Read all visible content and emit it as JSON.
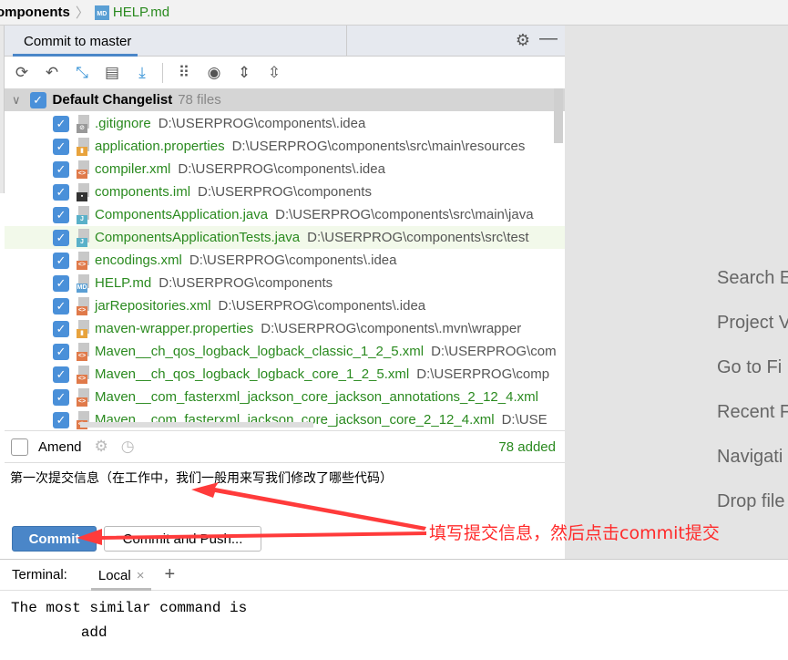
{
  "breadcrumb": {
    "project": "omponents",
    "file": "HELP.md"
  },
  "commit_panel": {
    "tab": "Commit to master",
    "changelist": {
      "name": "Default Changelist",
      "count": "78 files"
    },
    "files": [
      {
        "name": ".gitignore",
        "path": "D:\\USERPROG\\components\\.idea",
        "type": "ignore"
      },
      {
        "name": "application.properties",
        "path": "D:\\USERPROG\\components\\src\\main\\resources",
        "type": "properties"
      },
      {
        "name": "compiler.xml",
        "path": "D:\\USERPROG\\components\\.idea",
        "type": "xml"
      },
      {
        "name": "components.iml",
        "path": "D:\\USERPROG\\components",
        "type": "iml"
      },
      {
        "name": "ComponentsApplication.java",
        "path": "D:\\USERPROG\\components\\src\\main\\java",
        "type": "java"
      },
      {
        "name": "ComponentsApplicationTests.java",
        "path": "D:\\USERPROG\\components\\src\\test",
        "type": "java"
      },
      {
        "name": "encodings.xml",
        "path": "D:\\USERPROG\\components\\.idea",
        "type": "xml"
      },
      {
        "name": "HELP.md",
        "path": "D:\\USERPROG\\components",
        "type": "md"
      },
      {
        "name": "jarRepositories.xml",
        "path": "D:\\USERPROG\\components\\.idea",
        "type": "xml"
      },
      {
        "name": "maven-wrapper.properties",
        "path": "D:\\USERPROG\\components\\.mvn\\wrapper",
        "type": "properties"
      },
      {
        "name": "Maven__ch_qos_logback_logback_classic_1_2_5.xml",
        "path": "D:\\USERPROG\\com",
        "type": "xml"
      },
      {
        "name": "Maven__ch_qos_logback_logback_core_1_2_5.xml",
        "path": "D:\\USERPROG\\comp",
        "type": "xml"
      },
      {
        "name": "Maven__com_fasterxml_jackson_core_jackson_annotations_2_12_4.xml",
        "path": "",
        "type": "xml"
      },
      {
        "name": "Maven__com_fasterxml_jackson_core_jackson_core_2_12_4.xml",
        "path": "D:\\USE",
        "type": "xml"
      }
    ],
    "amend_label": "Amend",
    "added_status": "78 added",
    "message": "第一次提交信息（在工作中，我们一般用来写我们修改了哪些代码）",
    "commit_label": "Commit",
    "commit_push_label": "Commit and Push..."
  },
  "right_panel": [
    "Search E",
    "Project V",
    "Go to Fi",
    "Recent F",
    "Navigati",
    "Drop file"
  ],
  "annotation": "填写提交信息，然后点击commit提交",
  "terminal": {
    "label": "Terminal:",
    "tab": "Local",
    "output": "The most similar command is\n        add"
  },
  "colors": {
    "accent": "#4a86c8",
    "added_file": "#2a8a1f",
    "annotation": "#ff2a2a"
  }
}
